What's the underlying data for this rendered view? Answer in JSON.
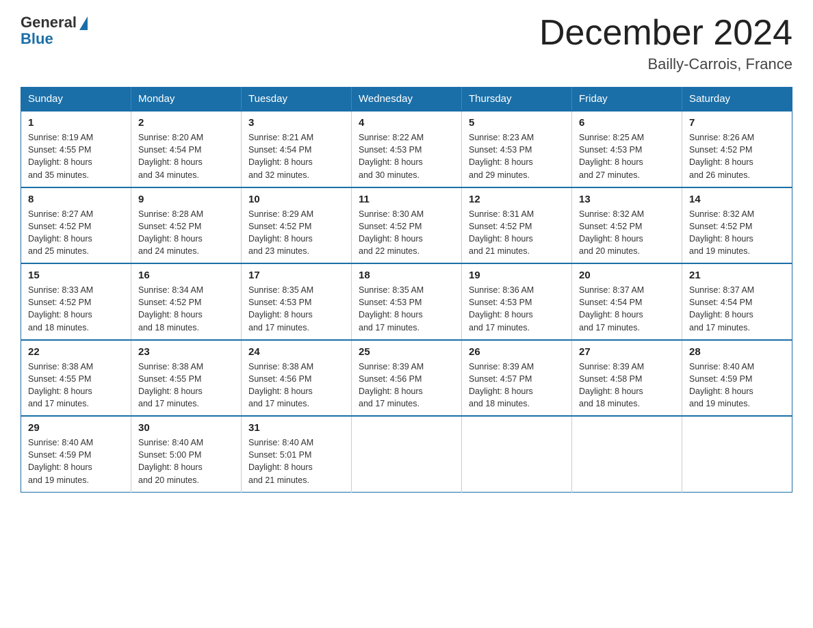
{
  "header": {
    "logo_general": "General",
    "logo_blue": "Blue",
    "month_title": "December 2024",
    "location": "Bailly-Carrois, France"
  },
  "days_of_week": [
    "Sunday",
    "Monday",
    "Tuesday",
    "Wednesday",
    "Thursday",
    "Friday",
    "Saturday"
  ],
  "weeks": [
    [
      {
        "day": "1",
        "sunrise": "8:19 AM",
        "sunset": "4:55 PM",
        "daylight": "8 hours and 35 minutes."
      },
      {
        "day": "2",
        "sunrise": "8:20 AM",
        "sunset": "4:54 PM",
        "daylight": "8 hours and 34 minutes."
      },
      {
        "day": "3",
        "sunrise": "8:21 AM",
        "sunset": "4:54 PM",
        "daylight": "8 hours and 32 minutes."
      },
      {
        "day": "4",
        "sunrise": "8:22 AM",
        "sunset": "4:53 PM",
        "daylight": "8 hours and 30 minutes."
      },
      {
        "day": "5",
        "sunrise": "8:23 AM",
        "sunset": "4:53 PM",
        "daylight": "8 hours and 29 minutes."
      },
      {
        "day": "6",
        "sunrise": "8:25 AM",
        "sunset": "4:53 PM",
        "daylight": "8 hours and 27 minutes."
      },
      {
        "day": "7",
        "sunrise": "8:26 AM",
        "sunset": "4:52 PM",
        "daylight": "8 hours and 26 minutes."
      }
    ],
    [
      {
        "day": "8",
        "sunrise": "8:27 AM",
        "sunset": "4:52 PM",
        "daylight": "8 hours and 25 minutes."
      },
      {
        "day": "9",
        "sunrise": "8:28 AM",
        "sunset": "4:52 PM",
        "daylight": "8 hours and 24 minutes."
      },
      {
        "day": "10",
        "sunrise": "8:29 AM",
        "sunset": "4:52 PM",
        "daylight": "8 hours and 23 minutes."
      },
      {
        "day": "11",
        "sunrise": "8:30 AM",
        "sunset": "4:52 PM",
        "daylight": "8 hours and 22 minutes."
      },
      {
        "day": "12",
        "sunrise": "8:31 AM",
        "sunset": "4:52 PM",
        "daylight": "8 hours and 21 minutes."
      },
      {
        "day": "13",
        "sunrise": "8:32 AM",
        "sunset": "4:52 PM",
        "daylight": "8 hours and 20 minutes."
      },
      {
        "day": "14",
        "sunrise": "8:32 AM",
        "sunset": "4:52 PM",
        "daylight": "8 hours and 19 minutes."
      }
    ],
    [
      {
        "day": "15",
        "sunrise": "8:33 AM",
        "sunset": "4:52 PM",
        "daylight": "8 hours and 18 minutes."
      },
      {
        "day": "16",
        "sunrise": "8:34 AM",
        "sunset": "4:52 PM",
        "daylight": "8 hours and 18 minutes."
      },
      {
        "day": "17",
        "sunrise": "8:35 AM",
        "sunset": "4:53 PM",
        "daylight": "8 hours and 17 minutes."
      },
      {
        "day": "18",
        "sunrise": "8:35 AM",
        "sunset": "4:53 PM",
        "daylight": "8 hours and 17 minutes."
      },
      {
        "day": "19",
        "sunrise": "8:36 AM",
        "sunset": "4:53 PM",
        "daylight": "8 hours and 17 minutes."
      },
      {
        "day": "20",
        "sunrise": "8:37 AM",
        "sunset": "4:54 PM",
        "daylight": "8 hours and 17 minutes."
      },
      {
        "day": "21",
        "sunrise": "8:37 AM",
        "sunset": "4:54 PM",
        "daylight": "8 hours and 17 minutes."
      }
    ],
    [
      {
        "day": "22",
        "sunrise": "8:38 AM",
        "sunset": "4:55 PM",
        "daylight": "8 hours and 17 minutes."
      },
      {
        "day": "23",
        "sunrise": "8:38 AM",
        "sunset": "4:55 PM",
        "daylight": "8 hours and 17 minutes."
      },
      {
        "day": "24",
        "sunrise": "8:38 AM",
        "sunset": "4:56 PM",
        "daylight": "8 hours and 17 minutes."
      },
      {
        "day": "25",
        "sunrise": "8:39 AM",
        "sunset": "4:56 PM",
        "daylight": "8 hours and 17 minutes."
      },
      {
        "day": "26",
        "sunrise": "8:39 AM",
        "sunset": "4:57 PM",
        "daylight": "8 hours and 18 minutes."
      },
      {
        "day": "27",
        "sunrise": "8:39 AM",
        "sunset": "4:58 PM",
        "daylight": "8 hours and 18 minutes."
      },
      {
        "day": "28",
        "sunrise": "8:40 AM",
        "sunset": "4:59 PM",
        "daylight": "8 hours and 19 minutes."
      }
    ],
    [
      {
        "day": "29",
        "sunrise": "8:40 AM",
        "sunset": "4:59 PM",
        "daylight": "8 hours and 19 minutes."
      },
      {
        "day": "30",
        "sunrise": "8:40 AM",
        "sunset": "5:00 PM",
        "daylight": "8 hours and 20 minutes."
      },
      {
        "day": "31",
        "sunrise": "8:40 AM",
        "sunset": "5:01 PM",
        "daylight": "8 hours and 21 minutes."
      },
      null,
      null,
      null,
      null
    ]
  ],
  "labels": {
    "sunrise": "Sunrise:",
    "sunset": "Sunset:",
    "daylight": "Daylight:"
  }
}
